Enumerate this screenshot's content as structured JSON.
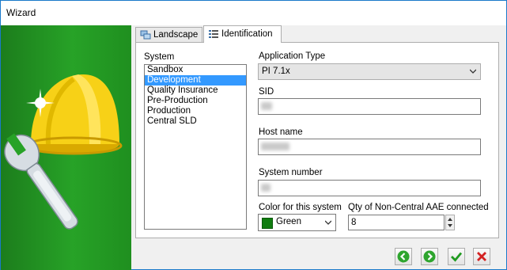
{
  "window": {
    "title": "Wizard"
  },
  "tabs": [
    {
      "label": "Landscape",
      "icon": "landscape-icon"
    },
    {
      "label": "Identification",
      "icon": "identification-icon"
    }
  ],
  "system": {
    "label": "System",
    "items": [
      "Sandbox",
      "Development",
      "Quality Insurance",
      "Pre-Production",
      "Production",
      "Central SLD"
    ],
    "selected": "Development"
  },
  "application_type": {
    "label": "Application Type",
    "value": "PI 7.1x"
  },
  "sid": {
    "label": "SID"
  },
  "host_name": {
    "label": "Host name"
  },
  "system_number": {
    "label": "System number"
  },
  "color": {
    "label": "Color for this system",
    "value": "Green",
    "swatch": "#107c10"
  },
  "qty": {
    "label": "Qty of Non-Central AAE connected",
    "value": "8"
  },
  "buttons": {
    "back": "arrow-left-icon",
    "next": "arrow-right-icon",
    "ok": "checkmark-icon",
    "cancel": "close-icon"
  },
  "colors": {
    "accent_green": "#27a227",
    "selection_blue": "#3399ff",
    "cancel_red": "#d32222",
    "helmet_yellow": "#f7d117"
  }
}
